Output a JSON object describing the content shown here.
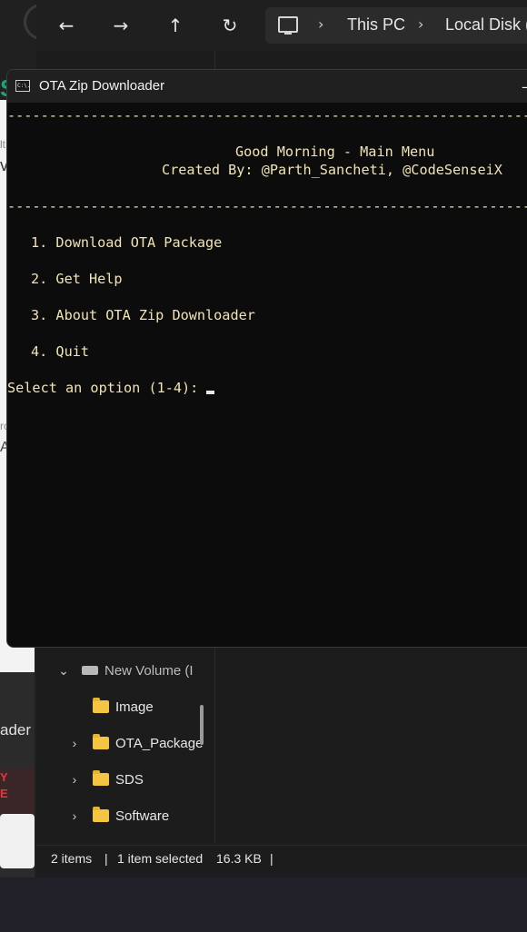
{
  "explorer": {
    "breadcrumb": [
      "This PC",
      "Local Disk (C"
    ],
    "nav_items": [
      {
        "label": "New Volume (I",
        "type": "drive",
        "expanded": true
      },
      {
        "label": "Image",
        "type": "folder"
      },
      {
        "label": "OTA_Package",
        "type": "folder"
      },
      {
        "label": "SDS",
        "type": "folder"
      },
      {
        "label": "Software",
        "type": "folder"
      }
    ],
    "status": {
      "item_count": "2 items",
      "selection": "1 item selected",
      "size": "16.3 KB"
    }
  },
  "left_app": {
    "fragments": [
      "lt",
      "vi",
      "ro",
      "A",
      "ader",
      "Y",
      "E"
    ]
  },
  "console": {
    "icon_text": "C:\\.",
    "title": "OTA Zip Downloader",
    "rule": "----------------------------------------------------------------------",
    "greeting": "Good Morning - Main Menu",
    "credits": "Created By: @Parth_Sancheti, @CodeSenseiX",
    "menu": [
      "1. Download OTA Package",
      "2. Get Help",
      "3. About OTA Zip Downloader",
      "4. Quit"
    ],
    "prompt": "Select an option (1-4): "
  },
  "icons": [
    "back-arrow-icon",
    "forward-arrow-icon",
    "up-arrow-icon",
    "refresh-icon",
    "pc-icon",
    "cmd-icon",
    "folder-icon",
    "drive-icon",
    "chevron-right-icon",
    "chevron-down-icon"
  ]
}
